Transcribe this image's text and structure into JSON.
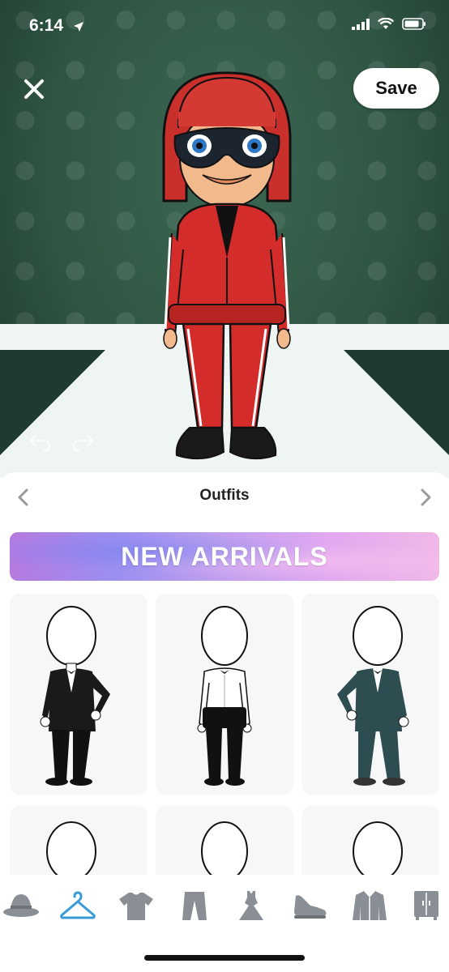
{
  "status_bar": {
    "time": "6:14"
  },
  "header": {
    "save_label": "Save"
  },
  "panel": {
    "title": "Outfits",
    "banner": "NEW ARRIVALS"
  },
  "outfits": [
    {
      "name": "black tuxedo"
    },
    {
      "name": "white shirt with cummerbund"
    },
    {
      "name": "teal tuxedo"
    },
    {
      "name": "outfit"
    },
    {
      "name": "outfit"
    },
    {
      "name": "outfit"
    }
  ],
  "tabs": [
    {
      "icon": "hat-icon",
      "active": false
    },
    {
      "icon": "hanger-icon",
      "active": true
    },
    {
      "icon": "tshirt-icon",
      "active": false
    },
    {
      "icon": "pants-icon",
      "active": false
    },
    {
      "icon": "dress-icon",
      "active": false
    },
    {
      "icon": "shoe-icon",
      "active": false
    },
    {
      "icon": "jacket-icon",
      "active": false
    },
    {
      "icon": "wardrobe-icon",
      "active": false
    }
  ],
  "colors": {
    "accent": "#3a9ad9",
    "tab_inactive": "#8a8f96",
    "stage_bg": "#2f5543"
  }
}
